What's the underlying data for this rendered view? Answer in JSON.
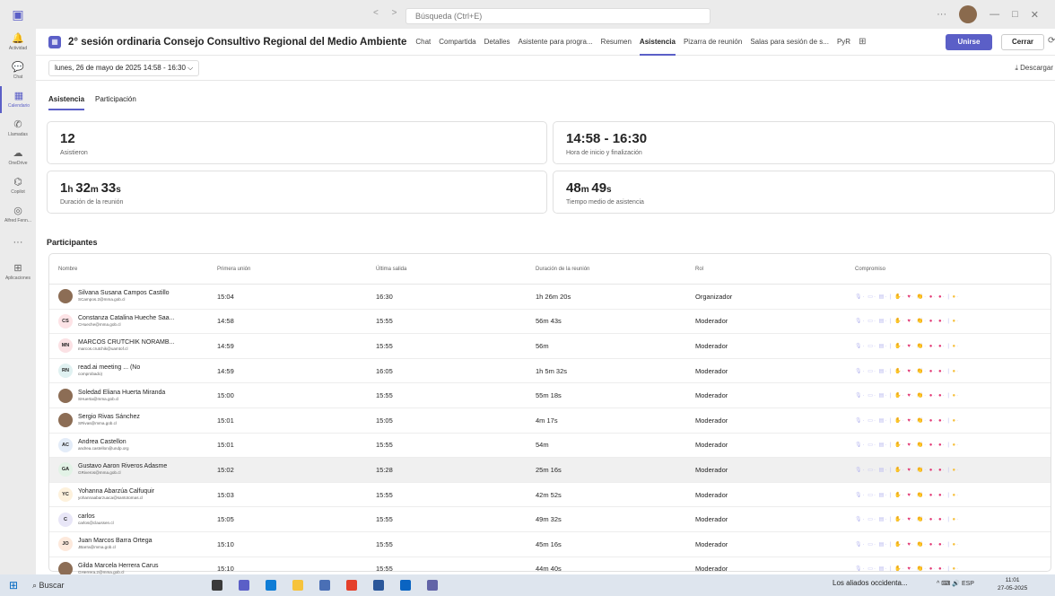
{
  "titlebar": {
    "search_placeholder": "Búsqueda (Ctrl+E)",
    "nav": "< >",
    "more": "···",
    "minimize": "—",
    "maximize": "□",
    "close": "✕"
  },
  "rail": [
    {
      "label": "Actividad",
      "icon": "bell-icon",
      "glyph": "🔔"
    },
    {
      "label": "Chat",
      "icon": "chat-icon",
      "glyph": "💬"
    },
    {
      "label": "Calendario",
      "icon": "calendar-icon",
      "glyph": "▦"
    },
    {
      "label": "Llamadas",
      "icon": "phone-icon",
      "glyph": "✆"
    },
    {
      "label": "OneDrive",
      "icon": "cloud-icon",
      "glyph": "☁"
    },
    {
      "label": "Copilot",
      "icon": "copilot-icon",
      "glyph": "⌬"
    },
    {
      "label": "Alfred Fenn...",
      "icon": "app-icon",
      "glyph": "◎"
    },
    {
      "label": "",
      "icon": "more-icon",
      "glyph": "···"
    },
    {
      "label": "Aplicaciones",
      "icon": "apps-icon",
      "glyph": "⊞"
    }
  ],
  "meeting": {
    "title": "2° sesión ordinaria Consejo Consultivo Regional del Medio Ambiente",
    "tabs": [
      "Chat",
      "Compartida",
      "Detalles",
      "Asistente para progra...",
      "Resumen",
      "Asistencia",
      "Pizarra de reunión",
      "Salas para sesión de s...",
      "PyR"
    ],
    "active_tab": "Asistencia",
    "join": "Unirse",
    "close": "Cerrar",
    "date": "lunes, 26 de mayo de 2025 14:58 - 16:30 ⌵",
    "download": "⤓ Descargar"
  },
  "subtabs": [
    "Asistencia",
    "Participación"
  ],
  "cards": [
    {
      "value": "12",
      "label": "Asistieron"
    },
    {
      "value": "14:58 - 16:30",
      "label": "Hora de inicio y finalización"
    },
    {
      "h": "1",
      "m": "32",
      "s": "33",
      "label": "Duración de la reunión"
    },
    {
      "m": "48",
      "s": "49",
      "label": "Tiempo medio de asistencia"
    }
  ],
  "participants_title": "Participantes",
  "columns": [
    "Nombre",
    "Primera unión",
    "Última salida",
    "Duración de la reunión",
    "Rol",
    "Compromiso"
  ],
  "rows": [
    {
      "name": "Silvana Susana Campos Castillo",
      "email": "SCampos.2@mma.gob.cl",
      "initials": "",
      "first": "15:04",
      "last": "16:30",
      "dur": "1h 26m 20s",
      "role": "Organizador"
    },
    {
      "name": "Constanza Catalina Hueche Saa...",
      "email": "CHueche@mma.gob.cl",
      "initials": "CS",
      "first": "14:58",
      "last": "15:55",
      "dur": "56m 43s",
      "role": "Moderador"
    },
    {
      "name": "MARCOS CRUTCHIK NORAMB...",
      "email": "marcos.crutchik@uamtof.cl",
      "initials": "MN",
      "first": "14:59",
      "last": "15:55",
      "dur": "56m",
      "role": "Moderador"
    },
    {
      "name": "read.ai meeting ... (No",
      "email": "comprobado)",
      "initials": "RN",
      "first": "14:59",
      "last": "16:05",
      "dur": "1h 5m 32s",
      "role": "Moderador"
    },
    {
      "name": "Soledad Eliana Huerta Miranda",
      "email": "SHuerta@mma.gob.cl",
      "initials": "",
      "first": "15:00",
      "last": "15:55",
      "dur": "55m 18s",
      "role": "Moderador"
    },
    {
      "name": "Sergio Rivas Sánchez",
      "email": "SRivas@mma.gob.cl",
      "initials": "",
      "first": "15:01",
      "last": "15:05",
      "dur": "4m 17s",
      "role": "Moderador"
    },
    {
      "name": "Andrea Castellon",
      "email": "andrea.castellon@undp.org",
      "initials": "AC",
      "first": "15:01",
      "last": "15:55",
      "dur": "54m",
      "role": "Moderador"
    },
    {
      "name": "Gustavo Aaron Riveros Adasme",
      "email": "GRiveros@mma.gob.cl",
      "initials": "GA",
      "first": "15:02",
      "last": "15:28",
      "dur": "25m 16s",
      "role": "Moderador"
    },
    {
      "name": "Yohanna Abarzúa Calfuquir",
      "email": "yohannaabarzuaca@santotomas.cl",
      "initials": "YC",
      "first": "15:03",
      "last": "15:55",
      "dur": "42m 52s",
      "role": "Moderador"
    },
    {
      "name": "carlos",
      "email": "carlos@claussen.cl",
      "initials": "C",
      "first": "15:05",
      "last": "15:55",
      "dur": "49m 32s",
      "role": "Moderador"
    },
    {
      "name": "Juan Marcos Barra Ortega",
      "email": "JBarra@mma.gob.cl",
      "initials": "JO",
      "first": "15:10",
      "last": "15:55",
      "dur": "45m 16s",
      "role": "Moderador"
    },
    {
      "name": "Gilda Marcela Herrera Carus",
      "email": "GHerrera.2@mma.gob.cl",
      "initials": "",
      "first": "15:10",
      "last": "15:55",
      "dur": "44m 40s",
      "role": "Moderador"
    }
  ],
  "avatar_colors": {
    "CS": "#fde3e6",
    "MN": "#fbe1e4",
    "RN": "#e0f1f1",
    "AC": "#e3ecf8",
    "GA": "#e2f2e6",
    "YC": "#fdf1dc",
    "C": "#e8e6f7",
    "JO": "#fde9dc"
  },
  "taskbar": {
    "search": "Buscar",
    "news": "Los aliados occidenta...",
    "tray": "^ ⌨ 🔊 ESP",
    "time": "11:01",
    "date": "27-05-2025"
  }
}
